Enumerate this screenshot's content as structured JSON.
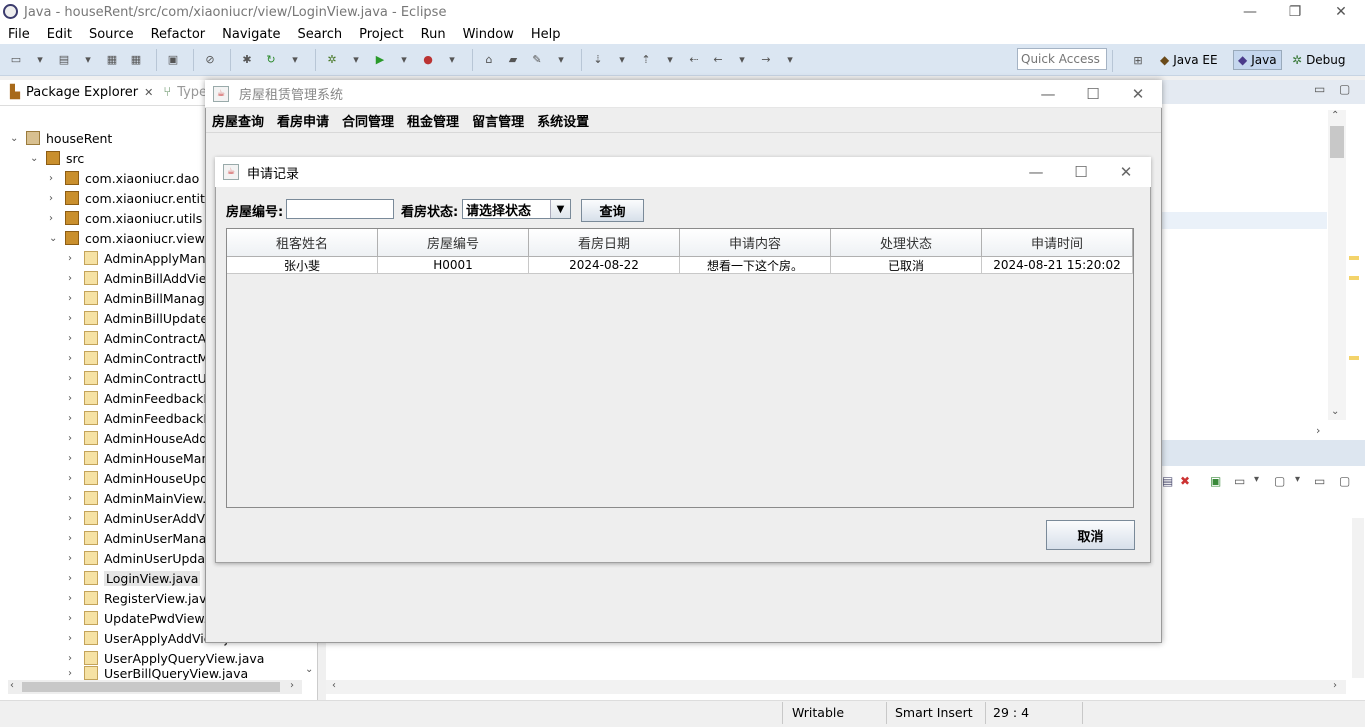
{
  "eclipse": {
    "title": "Java - houseRent/src/com/xiaoniucr/view/LoginView.java - Eclipse",
    "menu": [
      "File",
      "Edit",
      "Source",
      "Refactor",
      "Navigate",
      "Search",
      "Project",
      "Run",
      "Window",
      "Help"
    ],
    "quick_access": "Quick Access",
    "perspectives": [
      "Java EE",
      "Java",
      "Debug"
    ],
    "tabs": {
      "package_explorer": "Package Explorer",
      "type": "Type"
    },
    "status": {
      "writable": "Writable",
      "insert_mode": "Smart Insert",
      "position": "29 : 4"
    }
  },
  "tree": {
    "project": "houseRent",
    "src": "src",
    "packages": [
      "com.xiaoniucr.dao",
      "com.xiaoniucr.entity",
      "com.xiaoniucr.utils",
      "com.xiaoniucr.view"
    ],
    "files": [
      "AdminApplyMana",
      "AdminBillAddView",
      "AdminBillManage",
      "AdminBillUpdateV",
      "AdminContractAd",
      "AdminContractMa",
      "AdminContractUp",
      "AdminFeedbackM",
      "AdminFeedbackR",
      "AdminHouseAddV",
      "AdminHouseMan",
      "AdminHouseUpd",
      "AdminMainView.j",
      "AdminUserAddVi",
      "AdminUserManag",
      "AdminUserUpdat",
      "LoginView.java",
      "RegisterView.java",
      "UpdatePwdView.j",
      "UserApplyAddView.java",
      "UserApplyQueryView.java",
      "UserBillQueryView.java"
    ]
  },
  "app": {
    "title": "房屋租赁管理系统",
    "menu": [
      "房屋查询",
      "看房申请",
      "合同管理",
      "租金管理",
      "留言管理",
      "系统设置"
    ]
  },
  "dialog": {
    "title": "申请记录",
    "house_no_label": "房屋编号:",
    "house_no_value": "",
    "status_label": "看房状态:",
    "status_selected": "请选择状态",
    "query_button": "查询",
    "cancel_button": "取消",
    "columns": [
      "租客姓名",
      "房屋编号",
      "看房日期",
      "申请内容",
      "处理状态",
      "申请时间"
    ],
    "rows": [
      [
        "张小斐",
        "H0001",
        "2024-08-22",
        "想看一下这个房。",
        "已取消",
        "2024-08-21 15:20:02"
      ]
    ]
  }
}
